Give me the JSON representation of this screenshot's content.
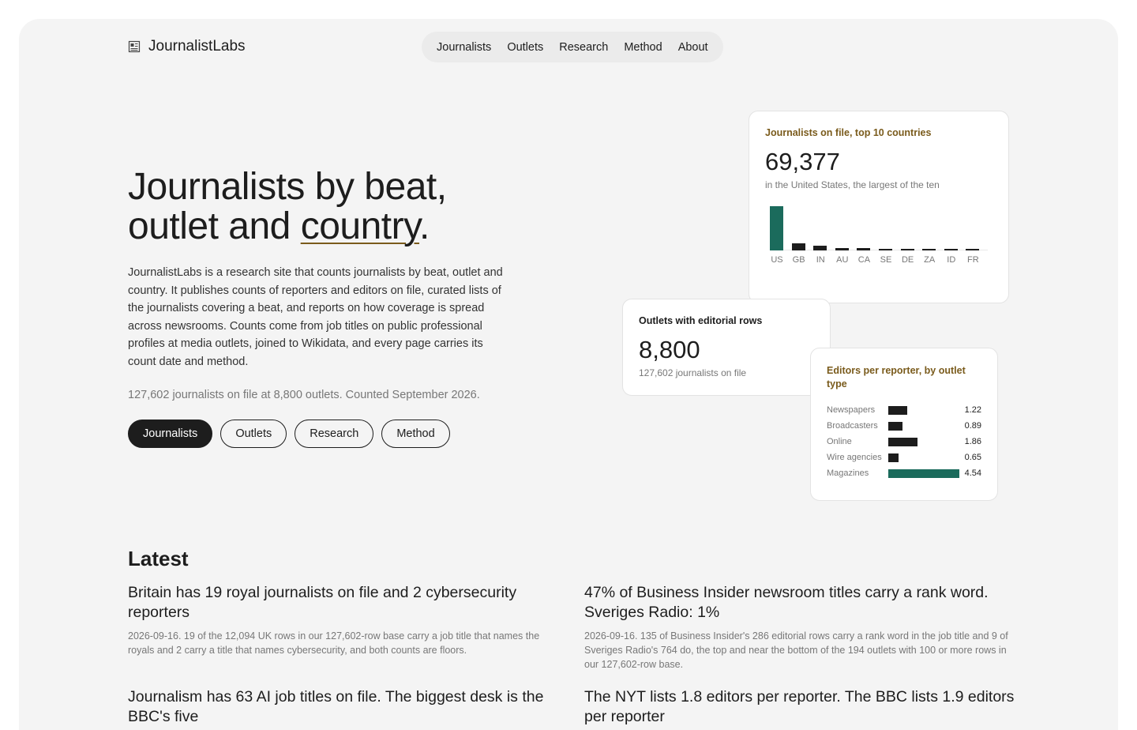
{
  "brand": {
    "name": "JournalistLabs",
    "icon": "newspaper-icon"
  },
  "nav": [
    "Journalists",
    "Outlets",
    "Research",
    "Method",
    "About"
  ],
  "hero": {
    "title_line1": "Journalists by beat,",
    "title_line2_a": "outlet and ",
    "title_line2_b": "country",
    "title_line2_c": ".",
    "description": "JournalistLabs is a research site that counts journalists by beat, outlet and country. It publishes counts of reporters and editors on file, curated lists of the journalists covering a beat, and reports on how coverage is spread across newsrooms. Counts come from job titles on public professional profiles at media outlets, joined to Wikidata, and every page carries its count date and method.",
    "meta": "127,602 journalists on file at 8,800 outlets. Counted September 2026.",
    "pills": [
      "Journalists",
      "Outlets",
      "Research",
      "Method"
    ],
    "active_pill": "Journalists"
  },
  "card_countries": {
    "title": "Journalists on file, top 10 countries",
    "value": "69,377",
    "subtitle": "in the United States, the largest of the ten"
  },
  "card_outlets": {
    "title": "Outlets with editorial rows",
    "value": "8,800",
    "subtitle": "127,602 journalists on file"
  },
  "card_editors": {
    "title": "Editors per reporter, by outlet type"
  },
  "chart_data": [
    {
      "type": "bar",
      "title": "Journalists on file, top 10 countries",
      "categories": [
        "US",
        "GB",
        "IN",
        "AU",
        "CA",
        "SE",
        "DE",
        "ZA",
        "ID",
        "FR"
      ],
      "values": [
        69377,
        11500,
        7200,
        4300,
        3100,
        1900,
        1700,
        1500,
        1400,
        1300
      ],
      "highlight": "US",
      "colors": {
        "highlight": "#1b6b5c",
        "default": "#1d1d1d"
      }
    },
    {
      "type": "bar",
      "orientation": "horizontal",
      "title": "Editors per reporter, by outlet type",
      "categories": [
        "Newspapers",
        "Broadcasters",
        "Online",
        "Wire agencies",
        "Magazines"
      ],
      "values": [
        1.22,
        0.89,
        1.86,
        0.65,
        4.54
      ],
      "value_labels": [
        "1.22",
        "0.89",
        "1.86",
        "0.65",
        "4.54"
      ],
      "highlight": "Magazines",
      "colors": {
        "highlight": "#1b6b5c",
        "default": "#1d1d1d"
      }
    }
  ],
  "latest": {
    "title": "Latest",
    "articles": [
      {
        "headline": "Britain has 19 royal journalists on file and 2 cybersecurity reporters",
        "summary": "2026-09-16. 19 of the 12,094 UK rows in our 127,602-row base carry a job title that names the royals and 2 carry a title that names cybersecurity, and both counts are floors."
      },
      {
        "headline": "47% of Business Insider newsroom titles carry a rank word. Sveriges Radio: 1%",
        "summary": "2026-09-16. 135 of Business Insider's 286 editorial rows carry a rank word in the job title and 9 of Sveriges Radio's 764 do, the top and near the bottom of the 194 outlets with 100 or more rows in our 127,602-row base."
      },
      {
        "headline": "Journalism has 63 AI job titles on file. The biggest desk is the BBC's five",
        "summary": ""
      },
      {
        "headline": "The NYT lists 1.8 editors per reporter. The BBC lists 1.9 editors per reporter",
        "summary": ""
      }
    ]
  }
}
